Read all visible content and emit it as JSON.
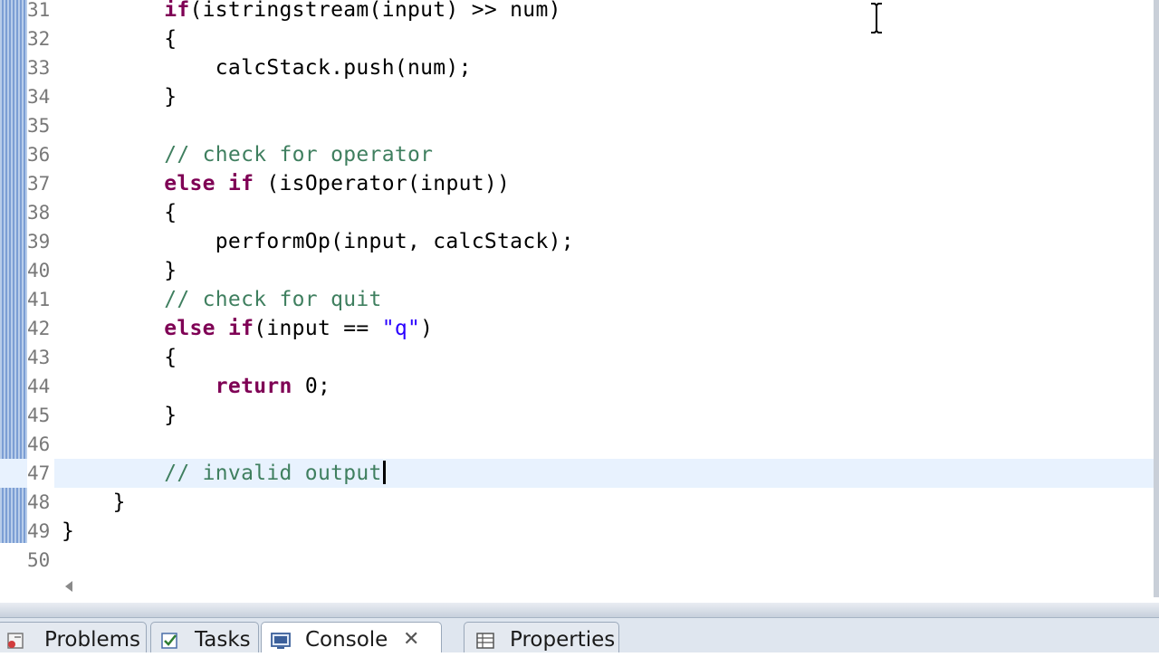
{
  "editor": {
    "lines": [
      {
        "num": "31",
        "indent": "        ",
        "tokens": [
          {
            "t": "if",
            "c": "kw"
          },
          {
            "t": "(istringstream(input) >> num)",
            "c": ""
          }
        ]
      },
      {
        "num": "32",
        "indent": "        ",
        "tokens": [
          {
            "t": "{",
            "c": ""
          }
        ]
      },
      {
        "num": "33",
        "indent": "            ",
        "tokens": [
          {
            "t": "calcStack.push(num);",
            "c": ""
          }
        ]
      },
      {
        "num": "34",
        "indent": "        ",
        "tokens": [
          {
            "t": "}",
            "c": ""
          }
        ]
      },
      {
        "num": "35",
        "indent": "",
        "tokens": []
      },
      {
        "num": "36",
        "indent": "        ",
        "tokens": [
          {
            "t": "// check for operator",
            "c": "cm"
          }
        ]
      },
      {
        "num": "37",
        "indent": "        ",
        "tokens": [
          {
            "t": "else",
            "c": "kw"
          },
          {
            "t": " ",
            "c": ""
          },
          {
            "t": "if",
            "c": "kw"
          },
          {
            "t": " (isOperator(input))",
            "c": ""
          }
        ]
      },
      {
        "num": "38",
        "indent": "        ",
        "tokens": [
          {
            "t": "{",
            "c": ""
          }
        ]
      },
      {
        "num": "39",
        "indent": "            ",
        "tokens": [
          {
            "t": "performOp(input, calcStack);",
            "c": ""
          }
        ]
      },
      {
        "num": "40",
        "indent": "        ",
        "tokens": [
          {
            "t": "}",
            "c": ""
          }
        ]
      },
      {
        "num": "41",
        "indent": "        ",
        "tokens": [
          {
            "t": "// check for quit",
            "c": "cm"
          }
        ]
      },
      {
        "num": "42",
        "indent": "        ",
        "tokens": [
          {
            "t": "else",
            "c": "kw"
          },
          {
            "t": " ",
            "c": ""
          },
          {
            "t": "if",
            "c": "kw"
          },
          {
            "t": "(input == ",
            "c": ""
          },
          {
            "t": "\"q\"",
            "c": "str"
          },
          {
            "t": ")",
            "c": ""
          }
        ]
      },
      {
        "num": "43",
        "indent": "        ",
        "tokens": [
          {
            "t": "{",
            "c": ""
          }
        ]
      },
      {
        "num": "44",
        "indent": "            ",
        "tokens": [
          {
            "t": "return",
            "c": "kw"
          },
          {
            "t": " 0;",
            "c": ""
          }
        ]
      },
      {
        "num": "45",
        "indent": "        ",
        "tokens": [
          {
            "t": "}",
            "c": ""
          }
        ]
      },
      {
        "num": "46",
        "indent": "",
        "tokens": []
      },
      {
        "num": "47",
        "indent": "        ",
        "tokens": [
          {
            "t": "// invalid output",
            "c": "cm"
          }
        ],
        "current": true
      },
      {
        "num": "48",
        "indent": "    ",
        "tokens": [
          {
            "t": "}",
            "c": ""
          }
        ]
      },
      {
        "num": "49",
        "indent": "",
        "tokens": [
          {
            "t": "}",
            "c": ""
          }
        ]
      },
      {
        "num": "50",
        "indent": "",
        "tokens": []
      }
    ]
  },
  "bottom_tabs": [
    {
      "label": "Problems",
      "icon": "problems-icon",
      "active": false,
      "closable": false
    },
    {
      "label": "Tasks",
      "icon": "tasks-icon",
      "active": false,
      "closable": false
    },
    {
      "label": "Console",
      "icon": "console-icon",
      "active": true,
      "closable": true
    },
    {
      "label": "Properties",
      "icon": "properties-icon",
      "active": false,
      "closable": false
    }
  ],
  "colors": {
    "keyword": "#7f0055",
    "comment": "#3f7f5f",
    "string": "#2a00ff",
    "current_line": "#e8f2fe"
  }
}
